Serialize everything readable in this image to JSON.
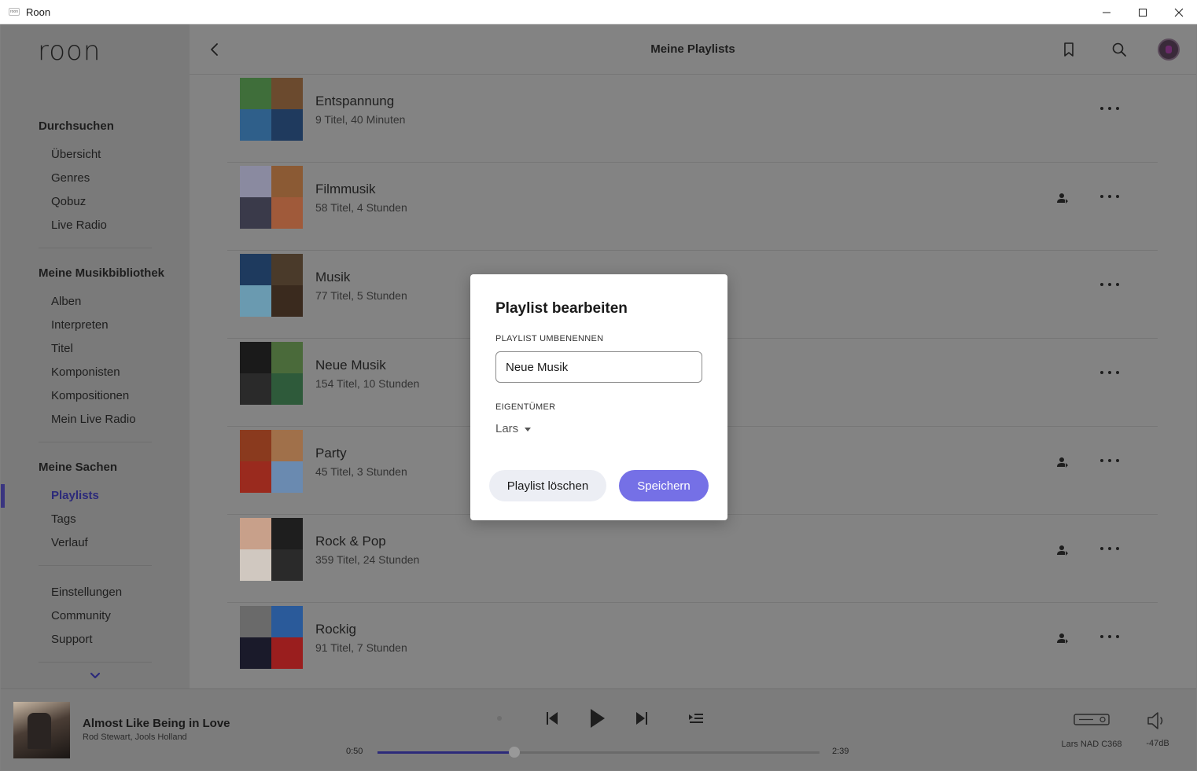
{
  "window": {
    "title": "Roon",
    "app_icon_text": "roon"
  },
  "sidebar": {
    "logo": "roon",
    "sections": [
      {
        "heading": "Durchsuchen",
        "items": [
          "Übersicht",
          "Genres",
          "Qobuz",
          "Live Radio"
        ]
      },
      {
        "heading": "Meine Musikbibliothek",
        "items": [
          "Alben",
          "Interpreten",
          "Titel",
          "Komponisten",
          "Kompositionen",
          "Mein Live Radio"
        ]
      },
      {
        "heading": "Meine Sachen",
        "items": [
          "Playlists",
          "Tags",
          "Verlauf"
        ]
      },
      {
        "heading": "",
        "items": [
          "Einstellungen",
          "Community",
          "Support"
        ]
      }
    ],
    "active_item": "Playlists"
  },
  "header": {
    "title": "Meine Playlists"
  },
  "playlists": [
    {
      "title": "Entspannung",
      "subtitle": "9 Titel, 40 Minuten",
      "shared": false,
      "covers": [
        "#3f6e3a",
        "#6b4a2e",
        "#2f5f8a",
        "#1f3a5e"
      ]
    },
    {
      "title": "Filmmusik",
      "subtitle": "58 Titel, 4 Stunden",
      "shared": true,
      "covers": [
        "#8a8aa0",
        "#8b5a34",
        "#3a3a4a",
        "#a05a3a"
      ]
    },
    {
      "title": "Musik",
      "subtitle": "77 Titel, 5 Stunden",
      "shared": false,
      "covers": [
        "#1e3a5e",
        "#4a3a2a",
        "#6a9ab0",
        "#3a2a1e"
      ]
    },
    {
      "title": "Neue Musik",
      "subtitle": "154 Titel, 10 Stunden",
      "shared": false,
      "covers": [
        "#1a1a1a",
        "#4a6a3a",
        "#2a2a2a",
        "#2e5a3a"
      ]
    },
    {
      "title": "Party",
      "subtitle": "45 Titel, 3 Stunden",
      "shared": true,
      "covers": [
        "#8a3a1e",
        "#a0704a",
        "#9a2a1e",
        "#6a8ab0"
      ]
    },
    {
      "title": "Rock & Pop",
      "subtitle": "359 Titel, 24 Stunden",
      "shared": true,
      "covers": [
        "#c8a08a",
        "#1e1e1e",
        "#d0c8c0",
        "#2a2a2a"
      ]
    },
    {
      "title": "Rockig",
      "subtitle": "91 Titel, 7 Stunden",
      "shared": true,
      "covers": [
        "#6a6a6a",
        "#2a5a9a",
        "#1a1a2a",
        "#9a1e1e"
      ]
    }
  ],
  "now_playing": {
    "title": "Almost Like Being in Love",
    "artist": "Rod Stewart, Jools Holland",
    "elapsed": "0:50",
    "duration": "2:39",
    "progress": 0.31
  },
  "zone": {
    "name": "Lars NAD C368",
    "volume": "-47dB"
  },
  "dialog": {
    "title": "Playlist bearbeiten",
    "rename_label": "PLAYLIST UMBENENNEN",
    "rename_value": "Neue Musik",
    "owner_label": "EIGENTÜMER",
    "owner_value": "Lars",
    "delete_label": "Playlist löschen",
    "save_label": "Speichern"
  },
  "colors": {
    "accent": "#7570e6",
    "active_nav": "#2c2a7a",
    "overlay_bg": "#7f7f7f"
  }
}
